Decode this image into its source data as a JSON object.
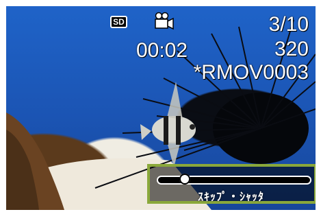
{
  "osd": {
    "media_badge": "SD",
    "mode_icon": "movie-camera-icon",
    "elapsed_time": "00:02",
    "frame_counter": "3/10",
    "resolution": "320",
    "file_name": "*RMOV0003"
  },
  "playback": {
    "position_fraction": 0.15,
    "hint": "ｽｷｯﾌﾟ・ｼｬｯﾀ"
  },
  "colors": {
    "water": "#1b54b3",
    "panel_border": "#8aa83a",
    "osd_text": "#ffffff"
  }
}
